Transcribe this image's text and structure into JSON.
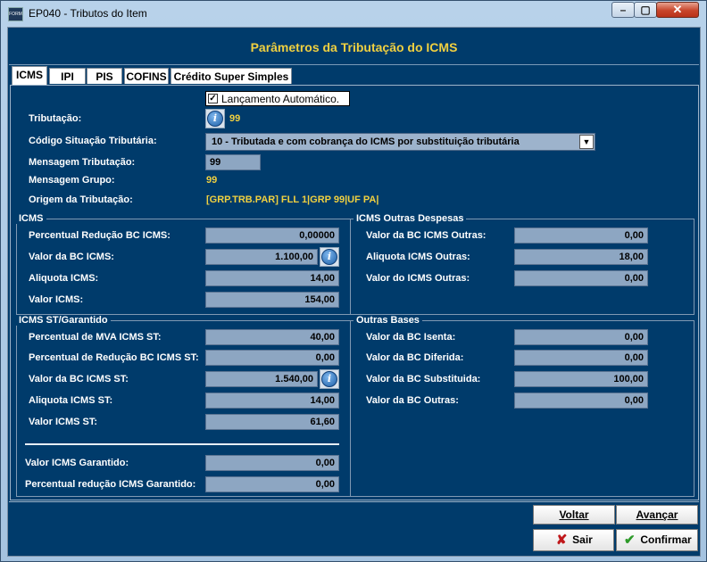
{
  "window": {
    "title": "EP040 - Tributos do Item",
    "app_icon_text": "FORM"
  },
  "controls": {
    "minimize": "–",
    "maximize": "▢",
    "close": "✕"
  },
  "header": {
    "title": "Parâmetros da Tributação do ICMS"
  },
  "tabs": [
    {
      "label": "ICMS",
      "active": true
    },
    {
      "label": "IPI",
      "active": false
    },
    {
      "label": "PIS",
      "active": false
    },
    {
      "label": "COFINS",
      "active": false
    },
    {
      "label": "Crédito Super Simples",
      "active": false
    }
  ],
  "top": {
    "auto_label": "Lançamento Automático.",
    "auto_checked": true,
    "tributacao_label": "Tributação:",
    "tributacao_value": "99",
    "cst_label": "Código Situação Tributária:",
    "cst_value": "10 - Tributada e com cobrança do ICMS por substituição tributária",
    "msg_trib_label": "Mensagem Tributação:",
    "msg_trib_value": "99",
    "msg_grupo_label": "Mensagem Grupo:",
    "msg_grupo_value": "99",
    "origem_label": "Origem da Tributação:",
    "origem_value": "[GRP.TRB.PAR] FLL 1|GRP 99|UF PA|"
  },
  "icms": {
    "title": "ICMS",
    "rows": [
      {
        "label": "Percentual Redução BC ICMS:",
        "value": "0,00000"
      },
      {
        "label": "Valor da BC ICMS:",
        "value": "1.100,00"
      },
      {
        "label": "Aliquota ICMS:",
        "value": "14,00"
      },
      {
        "label": "Valor ICMS:",
        "value": "154,00"
      }
    ]
  },
  "outras_despesas": {
    "title": "ICMS Outras Despesas",
    "rows": [
      {
        "label": "Valor da BC ICMS Outras:",
        "value": "0,00"
      },
      {
        "label": "Aliquota ICMS Outras:",
        "value": "18,00"
      },
      {
        "label": "Valor do ICMS Outras:",
        "value": "0,00"
      }
    ]
  },
  "st": {
    "title": "ICMS ST/Garantido",
    "rows": [
      {
        "label": "Percentual de MVA ICMS ST:",
        "value": "40,00"
      },
      {
        "label": "Percentual de Redução BC ICMS ST:",
        "value": "0,00"
      },
      {
        "label": "Valor da BC ICMS ST:",
        "value": "1.540,00"
      },
      {
        "label": "Aliquota ICMS ST:",
        "value": "14,00"
      },
      {
        "label": "Valor ICMS ST:",
        "value": "61,60"
      }
    ],
    "garantido_rows": [
      {
        "label": "Valor ICMS Garantido:",
        "value": "0,00"
      },
      {
        "label": "Percentual redução ICMS Garantido:",
        "value": "0,00"
      }
    ]
  },
  "outras_bases": {
    "title": "Outras Bases",
    "rows": [
      {
        "label": "Valor da BC Isenta:",
        "value": "0,00"
      },
      {
        "label": "Valor da BC Diferida:",
        "value": "0,00"
      },
      {
        "label": "Valor da BC Substituida:",
        "value": "100,00"
      },
      {
        "label": "Valor da BC Outras:",
        "value": "0,00"
      }
    ]
  },
  "buttons": {
    "voltar": "Voltar",
    "avancar": "Avançar",
    "sair": "Sair",
    "confirmar": "Confirmar"
  },
  "colors": {
    "panel_bg": "#003b6b",
    "field_bg": "#8da6c2",
    "accent_yellow": "#f0d040"
  }
}
